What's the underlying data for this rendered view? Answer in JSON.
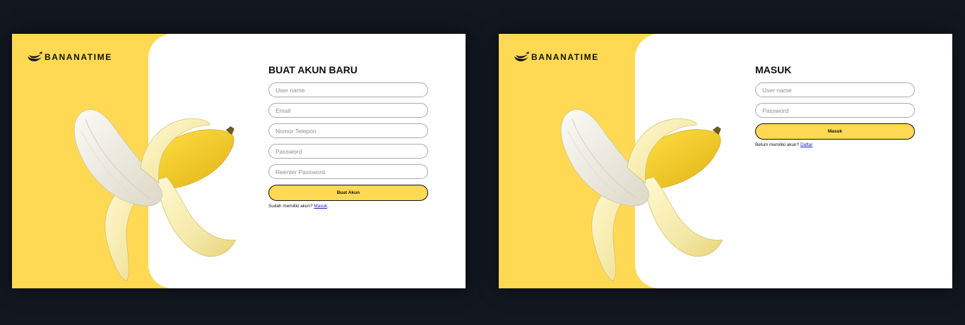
{
  "register": {
    "brand": "BANANATIME",
    "title": "BUAT AKUN BARU",
    "fields": {
      "username_placeholder": "User name",
      "email_placeholder": "Email",
      "phone_placeholder": "Nomor Telepon",
      "password_placeholder": "Password",
      "reenter_placeholder": "Reenter Password"
    },
    "submit_label": "Buat Akun",
    "alt_text": "Sudah memiliki akun?",
    "alt_link": "Masuk",
    "alt_suffix": "."
  },
  "login": {
    "brand": "BANANATIME",
    "title": "MASUK",
    "fields": {
      "username_placeholder": "User name",
      "password_placeholder": "Password"
    },
    "submit_label": "Masuk",
    "alt_text": "Belum memiliki akun?",
    "alt_link": "Daftar"
  },
  "colors": {
    "accent": "#ffd953",
    "page_background": "#131720",
    "text": "#111111",
    "link": "#1a1acc"
  },
  "icons": {
    "brand_logo": "banana-logo-icon",
    "illustration": "peeled-banana-illustration"
  }
}
